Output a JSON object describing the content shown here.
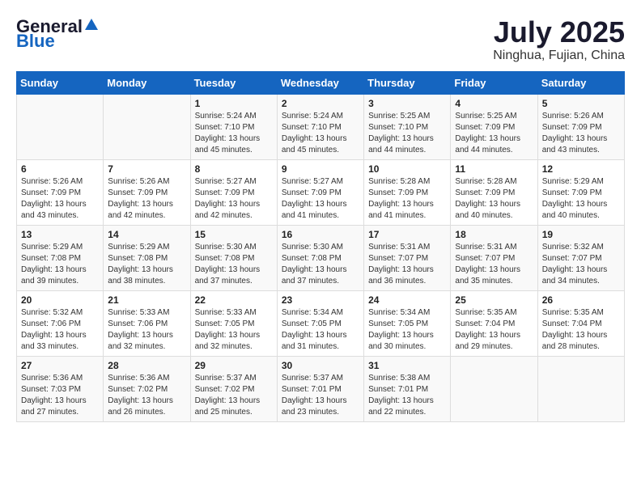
{
  "header": {
    "logo_general": "General",
    "logo_blue": "Blue",
    "month_year": "July 2025",
    "location": "Ninghua, Fujian, China"
  },
  "weekdays": [
    "Sunday",
    "Monday",
    "Tuesday",
    "Wednesday",
    "Thursday",
    "Friday",
    "Saturday"
  ],
  "weeks": [
    {
      "days": [
        {
          "num": "",
          "info": ""
        },
        {
          "num": "",
          "info": ""
        },
        {
          "num": "1",
          "info": "Sunrise: 5:24 AM\nSunset: 7:10 PM\nDaylight: 13 hours and 45 minutes."
        },
        {
          "num": "2",
          "info": "Sunrise: 5:24 AM\nSunset: 7:10 PM\nDaylight: 13 hours and 45 minutes."
        },
        {
          "num": "3",
          "info": "Sunrise: 5:25 AM\nSunset: 7:10 PM\nDaylight: 13 hours and 44 minutes."
        },
        {
          "num": "4",
          "info": "Sunrise: 5:25 AM\nSunset: 7:09 PM\nDaylight: 13 hours and 44 minutes."
        },
        {
          "num": "5",
          "info": "Sunrise: 5:26 AM\nSunset: 7:09 PM\nDaylight: 13 hours and 43 minutes."
        }
      ]
    },
    {
      "days": [
        {
          "num": "6",
          "info": "Sunrise: 5:26 AM\nSunset: 7:09 PM\nDaylight: 13 hours and 43 minutes."
        },
        {
          "num": "7",
          "info": "Sunrise: 5:26 AM\nSunset: 7:09 PM\nDaylight: 13 hours and 42 minutes."
        },
        {
          "num": "8",
          "info": "Sunrise: 5:27 AM\nSunset: 7:09 PM\nDaylight: 13 hours and 42 minutes."
        },
        {
          "num": "9",
          "info": "Sunrise: 5:27 AM\nSunset: 7:09 PM\nDaylight: 13 hours and 41 minutes."
        },
        {
          "num": "10",
          "info": "Sunrise: 5:28 AM\nSunset: 7:09 PM\nDaylight: 13 hours and 41 minutes."
        },
        {
          "num": "11",
          "info": "Sunrise: 5:28 AM\nSunset: 7:09 PM\nDaylight: 13 hours and 40 minutes."
        },
        {
          "num": "12",
          "info": "Sunrise: 5:29 AM\nSunset: 7:09 PM\nDaylight: 13 hours and 40 minutes."
        }
      ]
    },
    {
      "days": [
        {
          "num": "13",
          "info": "Sunrise: 5:29 AM\nSunset: 7:08 PM\nDaylight: 13 hours and 39 minutes."
        },
        {
          "num": "14",
          "info": "Sunrise: 5:29 AM\nSunset: 7:08 PM\nDaylight: 13 hours and 38 minutes."
        },
        {
          "num": "15",
          "info": "Sunrise: 5:30 AM\nSunset: 7:08 PM\nDaylight: 13 hours and 37 minutes."
        },
        {
          "num": "16",
          "info": "Sunrise: 5:30 AM\nSunset: 7:08 PM\nDaylight: 13 hours and 37 minutes."
        },
        {
          "num": "17",
          "info": "Sunrise: 5:31 AM\nSunset: 7:07 PM\nDaylight: 13 hours and 36 minutes."
        },
        {
          "num": "18",
          "info": "Sunrise: 5:31 AM\nSunset: 7:07 PM\nDaylight: 13 hours and 35 minutes."
        },
        {
          "num": "19",
          "info": "Sunrise: 5:32 AM\nSunset: 7:07 PM\nDaylight: 13 hours and 34 minutes."
        }
      ]
    },
    {
      "days": [
        {
          "num": "20",
          "info": "Sunrise: 5:32 AM\nSunset: 7:06 PM\nDaylight: 13 hours and 33 minutes."
        },
        {
          "num": "21",
          "info": "Sunrise: 5:33 AM\nSunset: 7:06 PM\nDaylight: 13 hours and 32 minutes."
        },
        {
          "num": "22",
          "info": "Sunrise: 5:33 AM\nSunset: 7:05 PM\nDaylight: 13 hours and 32 minutes."
        },
        {
          "num": "23",
          "info": "Sunrise: 5:34 AM\nSunset: 7:05 PM\nDaylight: 13 hours and 31 minutes."
        },
        {
          "num": "24",
          "info": "Sunrise: 5:34 AM\nSunset: 7:05 PM\nDaylight: 13 hours and 30 minutes."
        },
        {
          "num": "25",
          "info": "Sunrise: 5:35 AM\nSunset: 7:04 PM\nDaylight: 13 hours and 29 minutes."
        },
        {
          "num": "26",
          "info": "Sunrise: 5:35 AM\nSunset: 7:04 PM\nDaylight: 13 hours and 28 minutes."
        }
      ]
    },
    {
      "days": [
        {
          "num": "27",
          "info": "Sunrise: 5:36 AM\nSunset: 7:03 PM\nDaylight: 13 hours and 27 minutes."
        },
        {
          "num": "28",
          "info": "Sunrise: 5:36 AM\nSunset: 7:02 PM\nDaylight: 13 hours and 26 minutes."
        },
        {
          "num": "29",
          "info": "Sunrise: 5:37 AM\nSunset: 7:02 PM\nDaylight: 13 hours and 25 minutes."
        },
        {
          "num": "30",
          "info": "Sunrise: 5:37 AM\nSunset: 7:01 PM\nDaylight: 13 hours and 23 minutes."
        },
        {
          "num": "31",
          "info": "Sunrise: 5:38 AM\nSunset: 7:01 PM\nDaylight: 13 hours and 22 minutes."
        },
        {
          "num": "",
          "info": ""
        },
        {
          "num": "",
          "info": ""
        }
      ]
    }
  ]
}
